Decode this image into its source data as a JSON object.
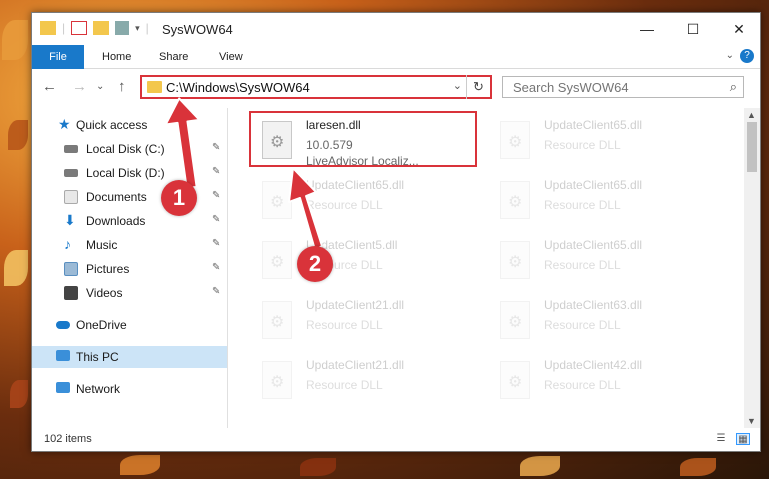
{
  "window": {
    "title": "SysWOW64",
    "minimize": "—",
    "maximize": "☐",
    "close": "✕"
  },
  "ribbon": {
    "tabs": [
      "File",
      "Home",
      "Share",
      "View"
    ],
    "expand": "⌄",
    "help": "?"
  },
  "nav": {
    "back": "←",
    "forward": "→",
    "recent": "⌄",
    "up": "↑",
    "address": "C:\\Windows\\SysWOW64",
    "address_dropdown": "⌄",
    "refresh": "↻",
    "search_placeholder": "Search SysWOW64",
    "search_icon": "⌕"
  },
  "sidebar": {
    "items": [
      {
        "label": "Quick access",
        "icon": "star-icon",
        "color": "#1979ca",
        "pinned": false
      },
      {
        "label": "Local Disk (C:)",
        "icon": "drive-icon",
        "color": "#7a7a7a",
        "pinned": true
      },
      {
        "label": "Local Disk (D:)",
        "icon": "drive-icon",
        "color": "#7a7a7a",
        "pinned": true
      },
      {
        "label": "Documents",
        "icon": "documents-icon",
        "color": "#a9a9a9",
        "pinned": true
      },
      {
        "label": "Downloads",
        "icon": "downloads-icon",
        "color": "#1979ca",
        "pinned": true
      },
      {
        "label": "Music",
        "icon": "music-icon",
        "color": "#1979ca",
        "pinned": true
      },
      {
        "label": "Pictures",
        "icon": "pictures-icon",
        "color": "#5a8fc0",
        "pinned": true
      },
      {
        "label": "Videos",
        "icon": "videos-icon",
        "color": "#444444",
        "pinned": true
      },
      {
        "label": "OneDrive",
        "icon": "onedrive-icon",
        "color": "#1979ca",
        "pinned": false
      },
      {
        "label": "This PC",
        "icon": "this-pc-icon",
        "color": "#3a8fd9",
        "pinned": false,
        "selected": true
      },
      {
        "label": "Network",
        "icon": "network-icon",
        "color": "#3a8fd9",
        "pinned": false
      }
    ],
    "pin_glyph": "📌"
  },
  "files": {
    "highlighted": {
      "name": "laresen.dll",
      "version": "10.0.579",
      "description": "LiveAdvisor Localiz..."
    },
    "others": [
      {
        "name": "UpdateClient65.dll",
        "type": "Resource DLL"
      },
      {
        "name": "UpdateClient65.dll",
        "type": "Resource DLL"
      },
      {
        "name": "UpdateClient65.dll",
        "type": "Resource DLL"
      },
      {
        "name": "UpdateClient5.dll",
        "type": "Resource DLL"
      },
      {
        "name": "UpdateClient65.dll",
        "type": "Resource DLL"
      },
      {
        "name": "UpdateClient21.dll",
        "type": "Resource DLL"
      },
      {
        "name": "UpdateClient63.dll",
        "type": "Resource DLL"
      },
      {
        "name": "UpdateClient21.dll",
        "type": "Resource DLL"
      },
      {
        "name": "UpdateClient42.dll",
        "type": "Resource DLL"
      }
    ]
  },
  "status": {
    "count": "102 items",
    "details_view": "☰",
    "tiles_view": "▦"
  },
  "annotations": {
    "step1": "1",
    "step2": "2",
    "color": "#d9333a"
  }
}
